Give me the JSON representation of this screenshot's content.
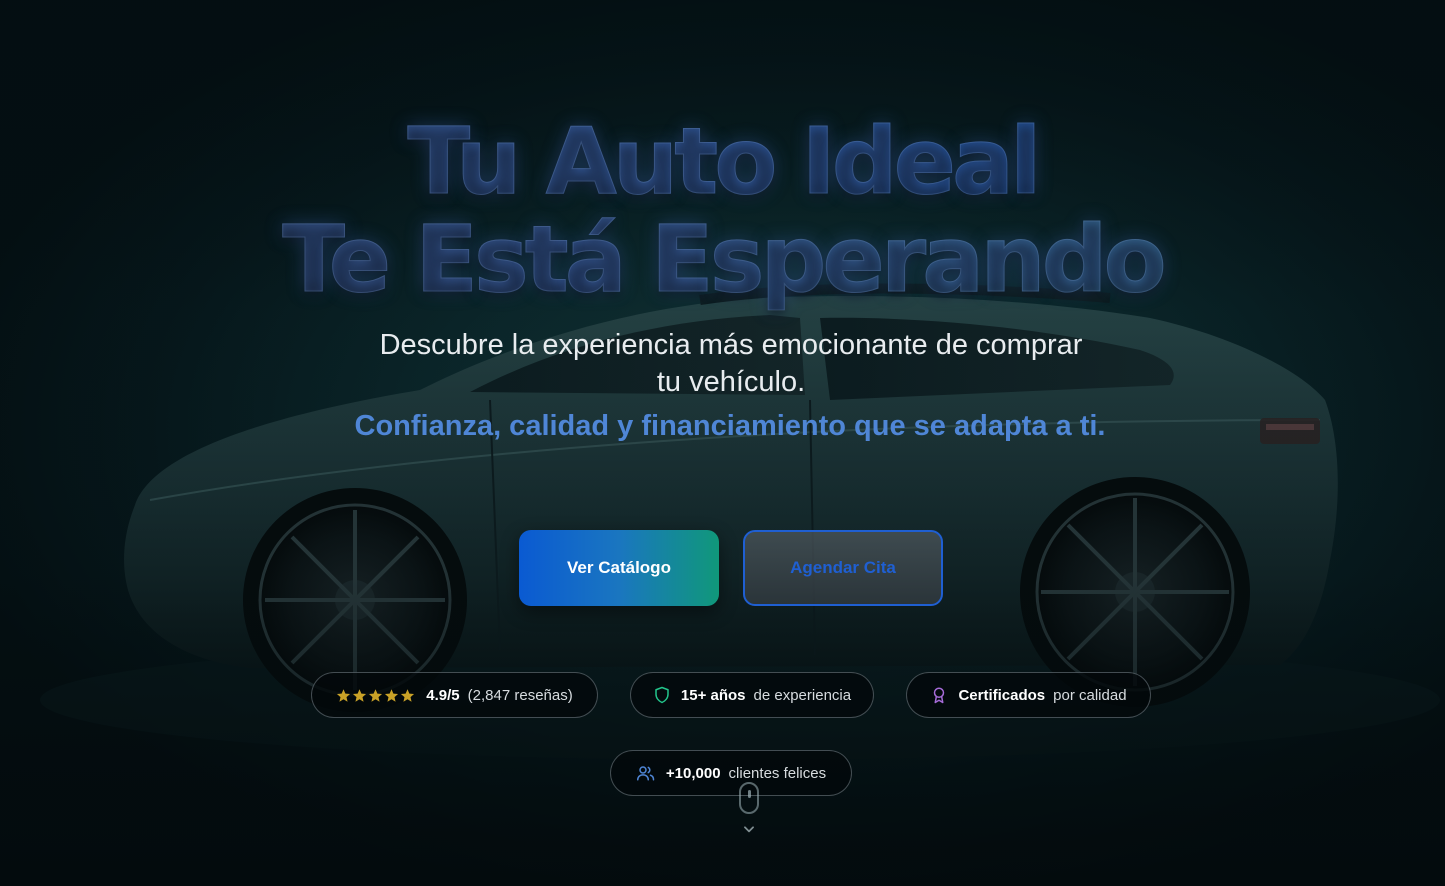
{
  "hero": {
    "title_line1": "Tu Auto Ideal",
    "title_line2": "Te Está Esperando",
    "subtitle": "Descubre la experiencia más emocionante de comprar tu vehículo.",
    "tagline": "Confianza, calidad y financiamiento que se adapta a ti."
  },
  "buttons": {
    "catalog_label": "Ver Catálogo",
    "appointment_label": "Agendar Cita"
  },
  "stats": {
    "rating": {
      "icon": "star-icon",
      "stars": 5,
      "value": "4.9/5",
      "reviews": "(2,847 reseñas)"
    },
    "experience": {
      "icon": "shield-icon",
      "value": "15+ años",
      "label": "de experiencia"
    },
    "certified": {
      "icon": "award-icon",
      "value": "Certificados",
      "label": "por calidad"
    },
    "clients": {
      "icon": "users-icon",
      "value": "+10,000",
      "label": "clientes felices"
    }
  },
  "colors": {
    "accent_blue": "#4f86d6",
    "primary_gradient_start": "#0a5ad2",
    "primary_gradient_end": "#10987a",
    "star": "#c9a227",
    "shield": "#22c58b",
    "award": "#a66bd8",
    "users": "#4f86d6"
  },
  "scroll_indicator": {
    "icon": "mouse-scroll-icon",
    "chevron": "chevron-down-icon"
  }
}
